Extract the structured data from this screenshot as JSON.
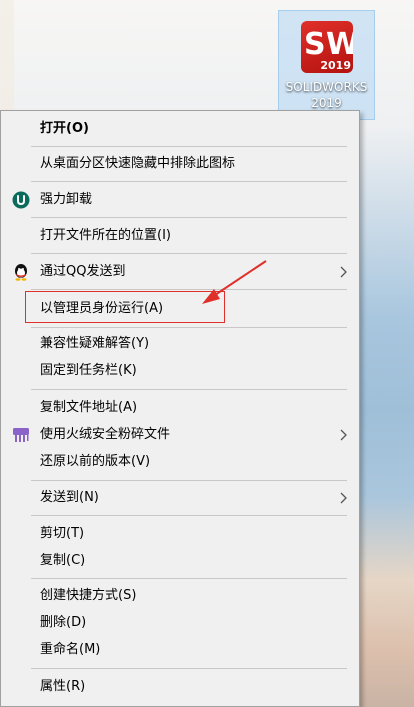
{
  "desktop": {
    "icon_label": "SOLIDWORKS 2019",
    "logo_letter_s": "S",
    "logo_letter_w": "W",
    "logo_year": "2019"
  },
  "menu": {
    "items": [
      {
        "label": "打开(O)",
        "icon": "",
        "submenu": false,
        "bold": true
      },
      {
        "label": "从桌面分区快速隐藏中排除此图标",
        "icon": "",
        "submenu": false
      },
      {
        "label": "强力卸载",
        "icon": "uninstall-icon",
        "submenu": false
      },
      {
        "label": "打开文件所在的位置(I)",
        "icon": "",
        "submenu": false
      },
      {
        "label": "通过QQ发送到",
        "icon": "qq-penguin-icon",
        "submenu": true
      },
      {
        "label": "以管理员身份运行(A)",
        "icon": "",
        "submenu": false
      },
      {
        "label": "兼容性疑难解答(Y)",
        "icon": "",
        "submenu": false
      },
      {
        "label": "固定到任务栏(K)",
        "icon": "",
        "submenu": false
      },
      {
        "label": "复制文件地址(A)",
        "icon": "",
        "submenu": false
      },
      {
        "label": "使用火绒安全粉碎文件",
        "icon": "shredder-icon",
        "submenu": true
      },
      {
        "label": "还原以前的版本(V)",
        "icon": "",
        "submenu": false
      },
      {
        "label": "发送到(N)",
        "icon": "",
        "submenu": true
      },
      {
        "label": "剪切(T)",
        "icon": "",
        "submenu": false
      },
      {
        "label": "复制(C)",
        "icon": "",
        "submenu": false
      },
      {
        "label": "创建快捷方式(S)",
        "icon": "",
        "submenu": false
      },
      {
        "label": "删除(D)",
        "icon": "",
        "submenu": false
      },
      {
        "label": "重命名(M)",
        "icon": "",
        "submenu": false
      },
      {
        "label": "属性(R)",
        "icon": "",
        "submenu": false
      }
    ]
  },
  "colors": {
    "annotation_red": "#e0302a",
    "menu_background": "#f0f0f0",
    "uninstall_icon": "#0b6b5c",
    "shredder_icon": "#8a62c8"
  }
}
